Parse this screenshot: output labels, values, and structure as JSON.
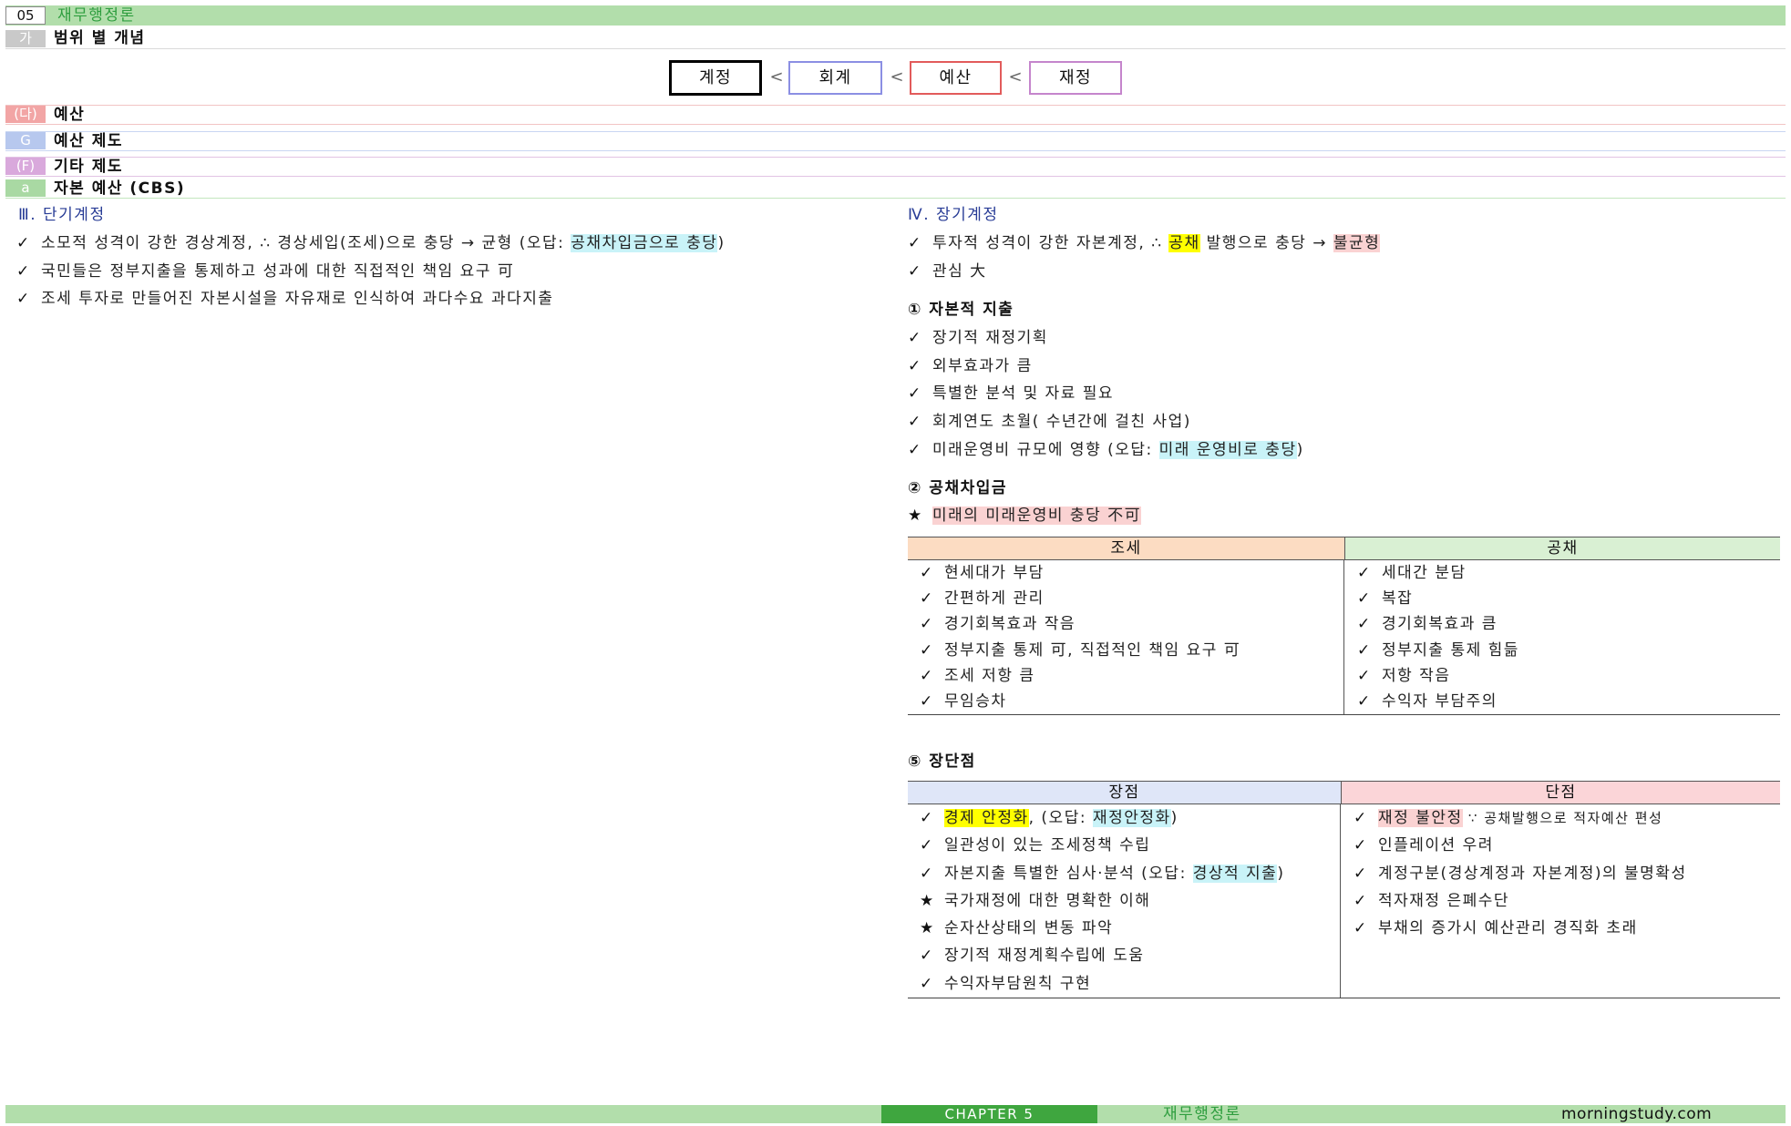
{
  "header": {
    "chapter_no": "05",
    "title": "재무행정론"
  },
  "section": {
    "label": "가",
    "title": "범위 별 개념"
  },
  "hierarchy": {
    "boxes": [
      "계정",
      "회계",
      "예산",
      "재정"
    ],
    "separator": "<"
  },
  "topics": [
    {
      "label": "(다)",
      "title": "예산"
    },
    {
      "label": "G",
      "title": "예산 제도"
    },
    {
      "label": "(F)",
      "title": "기타 제도"
    },
    {
      "label": "a",
      "title": "자본 예산 (CBS)"
    }
  ],
  "short_term": {
    "heading": "Ⅲ. 단기계정",
    "items": [
      {
        "mark": "✓",
        "parts": [
          "소모적 성격이 강한 경상계정, ∴ 경상세입(조세)으로 충당 → 균형 (오답: ",
          "공채차입금으로 충당",
          ")"
        ]
      },
      {
        "mark": "✓",
        "text": "국민들은 정부지출을 통제하고 성과에 대한 직접적인 책임 요구 可"
      },
      {
        "mark": "✓",
        "text": "조세 투자로 만들어진 자본시설을 자유재로 인식하여 과다수요 과다지출"
      }
    ]
  },
  "long_term": {
    "heading": "Ⅳ. 장기계정",
    "items": [
      {
        "mark": "✓",
        "parts": [
          "투자적 성격이 강한 자본계정, ∴ ",
          "공채",
          " 발행으로 충당 → ",
          "불균형"
        ]
      },
      {
        "mark": "✓",
        "text": "관심 大"
      }
    ]
  },
  "capital_expenditure": {
    "heading": "① 자본적 지출",
    "items": [
      {
        "mark": "✓",
        "text": "장기적 재정기획"
      },
      {
        "mark": "✓",
        "text": "외부효과가 큼"
      },
      {
        "mark": "✓",
        "text": "특별한 분석 및 자료 필요"
      },
      {
        "mark": "✓",
        "text": "회계연도 초월( 수년간에 걸친 사업)"
      },
      {
        "mark": "✓",
        "parts": [
          "미래운영비 규모에 영향 (오답: ",
          "미래 운영비로 충당",
          ")"
        ]
      }
    ]
  },
  "bond_borrowing": {
    "heading": "② 공채차입금",
    "note": {
      "mark": "★",
      "text": "미래의 미래운영비 충당 不可"
    },
    "table": {
      "headers": [
        "조세",
        "공채"
      ],
      "tax": [
        {
          "mark": "✓",
          "text": "현세대가 부담"
        },
        {
          "mark": "✓",
          "text": "간편하게 관리"
        },
        {
          "mark": "✓",
          "text": "경기회복효과 작음"
        },
        {
          "mark": "✓",
          "text": "정부지출 통제 可, 직접적인 책임 요구 可"
        },
        {
          "mark": "✓",
          "text": "조세 저항 큼"
        },
        {
          "mark": "✓",
          "text": "무임승차"
        }
      ],
      "bond": [
        {
          "mark": "✓",
          "text": "세대간 분담"
        },
        {
          "mark": "✓",
          "text": "복잡"
        },
        {
          "mark": "✓",
          "text": "경기회복효과 큼"
        },
        {
          "mark": "✓",
          "text": "정부지출 통제 힘듦"
        },
        {
          "mark": "✓",
          "text": "저항 작음"
        },
        {
          "mark": "✓",
          "text": "수익자 부담주의"
        }
      ]
    }
  },
  "pros_cons": {
    "heading": "⑤ 장단점",
    "headers": [
      "장점",
      "단점"
    ],
    "pros": [
      {
        "mark": "✓",
        "parts": [
          "경제 안정화",
          ", (오답: ",
          "재정안정화",
          ")"
        ]
      },
      {
        "mark": "✓",
        "text": "일관성이 있는 조세정책 수립"
      },
      {
        "mark": "✓",
        "parts": [
          "자본지출 특별한 심사·분석 (오답: ",
          "경상적 지출",
          ")"
        ]
      },
      {
        "mark": "★",
        "text": "국가재정에 대한 명확한 이해"
      },
      {
        "mark": "★",
        "text": "순자산상태의 변동 파악"
      },
      {
        "mark": "✓",
        "text": "장기적 재정계획수립에 도움"
      },
      {
        "mark": "✓",
        "text": "수익자부담원칙 구현"
      }
    ],
    "cons": [
      {
        "mark": "✓",
        "parts": [
          "재정 불안정",
          " ∵ 공채발행으로 적자예산 편성"
        ]
      },
      {
        "mark": "✓",
        "text": "인플레이션 우려"
      },
      {
        "mark": "✓",
        "text": "계정구분(경상계정과 자본계정)의 불명확성"
      },
      {
        "mark": "✓",
        "text": "적자재정 은폐수단"
      },
      {
        "mark": "✓",
        "text": "부채의 증가시 예산관리 경직화 초래"
      }
    ]
  },
  "footer": {
    "chapter": "CHAPTER 5",
    "subject": "재무행정론",
    "site": "morningstudy.com"
  },
  "colors": {
    "green_band": "#b2deab",
    "green_text": "#2f9e3f",
    "chapter_bg": "#3fa63f",
    "label_gray": "#c9c9c9",
    "label_pink": "#f2a5a5",
    "label_blue": "#b7c8ee",
    "label_purple": "#d9a9dc",
    "label_green": "#a9d9a3",
    "line_pink": "#f2c4c4",
    "line_blue": "#c9d6f2",
    "line_purple": "#e2c3e4",
    "line_green": "#c3e6be",
    "heading_blue": "#283c96",
    "hl_yellow": "#ffff00",
    "hl_cyan": "#c9f3f8",
    "hl_pink": "#fad2d2",
    "box_black": "#000000",
    "box_blue": "#8b8fe3",
    "box_red": "#e25b5b",
    "box_purple": "#c585cc",
    "th_tax": "#fcdcc2",
    "th_bond": "#d9f0d3",
    "th_pros": "#dfe6f8",
    "th_cons": "#fbd5d8"
  }
}
